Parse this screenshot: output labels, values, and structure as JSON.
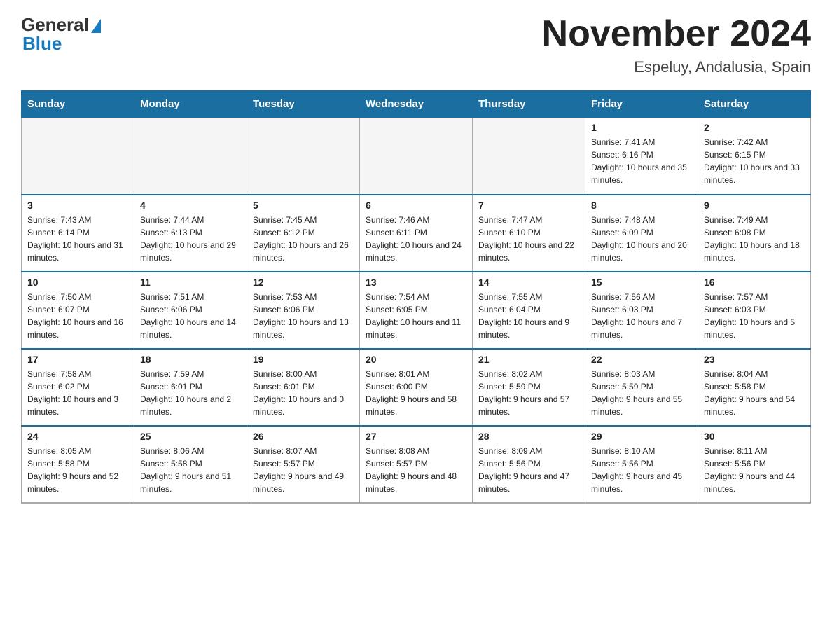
{
  "header": {
    "logo_general": "General",
    "logo_blue": "Blue",
    "month": "November 2024",
    "location": "Espeluy, Andalusia, Spain"
  },
  "days_of_week": [
    "Sunday",
    "Monday",
    "Tuesday",
    "Wednesday",
    "Thursday",
    "Friday",
    "Saturday"
  ],
  "weeks": [
    [
      {
        "day": "",
        "sunrise": "",
        "sunset": "",
        "daylight": "",
        "empty": true
      },
      {
        "day": "",
        "sunrise": "",
        "sunset": "",
        "daylight": "",
        "empty": true
      },
      {
        "day": "",
        "sunrise": "",
        "sunset": "",
        "daylight": "",
        "empty": true
      },
      {
        "day": "",
        "sunrise": "",
        "sunset": "",
        "daylight": "",
        "empty": true
      },
      {
        "day": "",
        "sunrise": "",
        "sunset": "",
        "daylight": "",
        "empty": true
      },
      {
        "day": "1",
        "sunrise": "Sunrise: 7:41 AM",
        "sunset": "Sunset: 6:16 PM",
        "daylight": "Daylight: 10 hours and 35 minutes.",
        "empty": false
      },
      {
        "day": "2",
        "sunrise": "Sunrise: 7:42 AM",
        "sunset": "Sunset: 6:15 PM",
        "daylight": "Daylight: 10 hours and 33 minutes.",
        "empty": false
      }
    ],
    [
      {
        "day": "3",
        "sunrise": "Sunrise: 7:43 AM",
        "sunset": "Sunset: 6:14 PM",
        "daylight": "Daylight: 10 hours and 31 minutes.",
        "empty": false
      },
      {
        "day": "4",
        "sunrise": "Sunrise: 7:44 AM",
        "sunset": "Sunset: 6:13 PM",
        "daylight": "Daylight: 10 hours and 29 minutes.",
        "empty": false
      },
      {
        "day": "5",
        "sunrise": "Sunrise: 7:45 AM",
        "sunset": "Sunset: 6:12 PM",
        "daylight": "Daylight: 10 hours and 26 minutes.",
        "empty": false
      },
      {
        "day": "6",
        "sunrise": "Sunrise: 7:46 AM",
        "sunset": "Sunset: 6:11 PM",
        "daylight": "Daylight: 10 hours and 24 minutes.",
        "empty": false
      },
      {
        "day": "7",
        "sunrise": "Sunrise: 7:47 AM",
        "sunset": "Sunset: 6:10 PM",
        "daylight": "Daylight: 10 hours and 22 minutes.",
        "empty": false
      },
      {
        "day": "8",
        "sunrise": "Sunrise: 7:48 AM",
        "sunset": "Sunset: 6:09 PM",
        "daylight": "Daylight: 10 hours and 20 minutes.",
        "empty": false
      },
      {
        "day": "9",
        "sunrise": "Sunrise: 7:49 AM",
        "sunset": "Sunset: 6:08 PM",
        "daylight": "Daylight: 10 hours and 18 minutes.",
        "empty": false
      }
    ],
    [
      {
        "day": "10",
        "sunrise": "Sunrise: 7:50 AM",
        "sunset": "Sunset: 6:07 PM",
        "daylight": "Daylight: 10 hours and 16 minutes.",
        "empty": false
      },
      {
        "day": "11",
        "sunrise": "Sunrise: 7:51 AM",
        "sunset": "Sunset: 6:06 PM",
        "daylight": "Daylight: 10 hours and 14 minutes.",
        "empty": false
      },
      {
        "day": "12",
        "sunrise": "Sunrise: 7:53 AM",
        "sunset": "Sunset: 6:06 PM",
        "daylight": "Daylight: 10 hours and 13 minutes.",
        "empty": false
      },
      {
        "day": "13",
        "sunrise": "Sunrise: 7:54 AM",
        "sunset": "Sunset: 6:05 PM",
        "daylight": "Daylight: 10 hours and 11 minutes.",
        "empty": false
      },
      {
        "day": "14",
        "sunrise": "Sunrise: 7:55 AM",
        "sunset": "Sunset: 6:04 PM",
        "daylight": "Daylight: 10 hours and 9 minutes.",
        "empty": false
      },
      {
        "day": "15",
        "sunrise": "Sunrise: 7:56 AM",
        "sunset": "Sunset: 6:03 PM",
        "daylight": "Daylight: 10 hours and 7 minutes.",
        "empty": false
      },
      {
        "day": "16",
        "sunrise": "Sunrise: 7:57 AM",
        "sunset": "Sunset: 6:03 PM",
        "daylight": "Daylight: 10 hours and 5 minutes.",
        "empty": false
      }
    ],
    [
      {
        "day": "17",
        "sunrise": "Sunrise: 7:58 AM",
        "sunset": "Sunset: 6:02 PM",
        "daylight": "Daylight: 10 hours and 3 minutes.",
        "empty": false
      },
      {
        "day": "18",
        "sunrise": "Sunrise: 7:59 AM",
        "sunset": "Sunset: 6:01 PM",
        "daylight": "Daylight: 10 hours and 2 minutes.",
        "empty": false
      },
      {
        "day": "19",
        "sunrise": "Sunrise: 8:00 AM",
        "sunset": "Sunset: 6:01 PM",
        "daylight": "Daylight: 10 hours and 0 minutes.",
        "empty": false
      },
      {
        "day": "20",
        "sunrise": "Sunrise: 8:01 AM",
        "sunset": "Sunset: 6:00 PM",
        "daylight": "Daylight: 9 hours and 58 minutes.",
        "empty": false
      },
      {
        "day": "21",
        "sunrise": "Sunrise: 8:02 AM",
        "sunset": "Sunset: 5:59 PM",
        "daylight": "Daylight: 9 hours and 57 minutes.",
        "empty": false
      },
      {
        "day": "22",
        "sunrise": "Sunrise: 8:03 AM",
        "sunset": "Sunset: 5:59 PM",
        "daylight": "Daylight: 9 hours and 55 minutes.",
        "empty": false
      },
      {
        "day": "23",
        "sunrise": "Sunrise: 8:04 AM",
        "sunset": "Sunset: 5:58 PM",
        "daylight": "Daylight: 9 hours and 54 minutes.",
        "empty": false
      }
    ],
    [
      {
        "day": "24",
        "sunrise": "Sunrise: 8:05 AM",
        "sunset": "Sunset: 5:58 PM",
        "daylight": "Daylight: 9 hours and 52 minutes.",
        "empty": false
      },
      {
        "day": "25",
        "sunrise": "Sunrise: 8:06 AM",
        "sunset": "Sunset: 5:58 PM",
        "daylight": "Daylight: 9 hours and 51 minutes.",
        "empty": false
      },
      {
        "day": "26",
        "sunrise": "Sunrise: 8:07 AM",
        "sunset": "Sunset: 5:57 PM",
        "daylight": "Daylight: 9 hours and 49 minutes.",
        "empty": false
      },
      {
        "day": "27",
        "sunrise": "Sunrise: 8:08 AM",
        "sunset": "Sunset: 5:57 PM",
        "daylight": "Daylight: 9 hours and 48 minutes.",
        "empty": false
      },
      {
        "day": "28",
        "sunrise": "Sunrise: 8:09 AM",
        "sunset": "Sunset: 5:56 PM",
        "daylight": "Daylight: 9 hours and 47 minutes.",
        "empty": false
      },
      {
        "day": "29",
        "sunrise": "Sunrise: 8:10 AM",
        "sunset": "Sunset: 5:56 PM",
        "daylight": "Daylight: 9 hours and 45 minutes.",
        "empty": false
      },
      {
        "day": "30",
        "sunrise": "Sunrise: 8:11 AM",
        "sunset": "Sunset: 5:56 PM",
        "daylight": "Daylight: 9 hours and 44 minutes.",
        "empty": false
      }
    ]
  ]
}
